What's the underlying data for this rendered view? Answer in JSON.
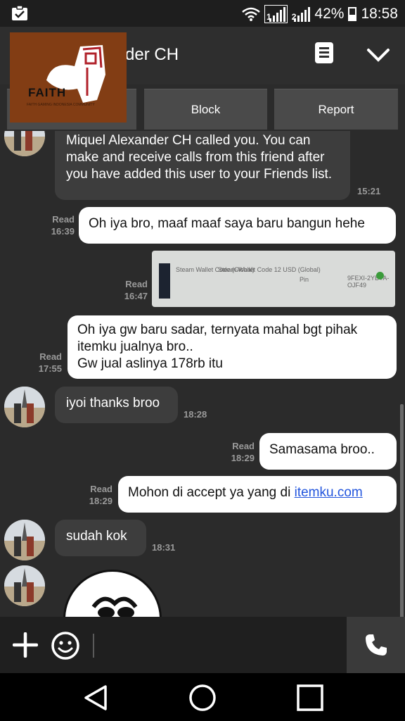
{
  "status_bar": {
    "sim1_label": "1",
    "sim2_label": "2",
    "battery_percent": "42%",
    "time": "18:58",
    "icons": [
      "clipboard-check-icon",
      "wifi-icon",
      "signal-icon",
      "battery-icon"
    ]
  },
  "header": {
    "contact_name": "der CH",
    "icons": [
      "menu-icon",
      "chevron-down-icon"
    ]
  },
  "logo": {
    "word": "FAITH",
    "tagline": "FAITH GAMING INDONESIA COMMUNITY"
  },
  "actions": {
    "block_label": "Block",
    "report_label": "Report"
  },
  "messages": [
    {
      "from": "friend",
      "text": "Miquel Alexander CH called you. You can make and receive calls from this friend after you have added this user to your Friends list.",
      "time": "15:21"
    },
    {
      "from": "me",
      "status": "Read",
      "time": "16:39",
      "text": "Oh iya bro, maaf maaf saya baru bangun hehe"
    },
    {
      "from": "me",
      "type": "image",
      "status": "Read",
      "time": "16:47",
      "image_texts": {
        "left": "Steam Wallet Code (Global)",
        "mid": "Steam Wallet Code 12 USD (Global)",
        "pin_label": "Pin",
        "code": "9FEXI-2YBYA-OJF49"
      }
    },
    {
      "from": "me",
      "status": "Read",
      "time": "17:55",
      "line1": "Oh iya gw baru sadar, ternyata mahal bgt pihak",
      "line2": "itemku jualnya bro..",
      "line3": "Gw jual aslinya 178rb itu"
    },
    {
      "from": "friend",
      "text": "iyoi thanks broo",
      "time": "18:28"
    },
    {
      "from": "me",
      "status": "Read",
      "time": "18:29",
      "text": "Samasama broo.."
    },
    {
      "from": "me",
      "status": "Read",
      "time": "18:29",
      "text_prefix": "Mohon di accept ya yang di ",
      "link_text": "itemku.com"
    },
    {
      "from": "friend",
      "text": "sudah kok",
      "time": "18:31"
    },
    {
      "from": "friend",
      "type": "sticker"
    }
  ],
  "input_bar": {
    "icons": [
      "plus-icon",
      "emoji-icon",
      "phone-call-icon"
    ]
  },
  "nav_bar": {
    "icons": [
      "back-icon",
      "home-icon",
      "recents-icon"
    ]
  },
  "colors": {
    "background": "#2b2b2b",
    "incoming_bubble": "#3d3d3d",
    "outgoing_bubble": "#ffffff",
    "action_button": "#4a4a4a",
    "link": "#2255dd",
    "logo_brown": "#823d14"
  }
}
